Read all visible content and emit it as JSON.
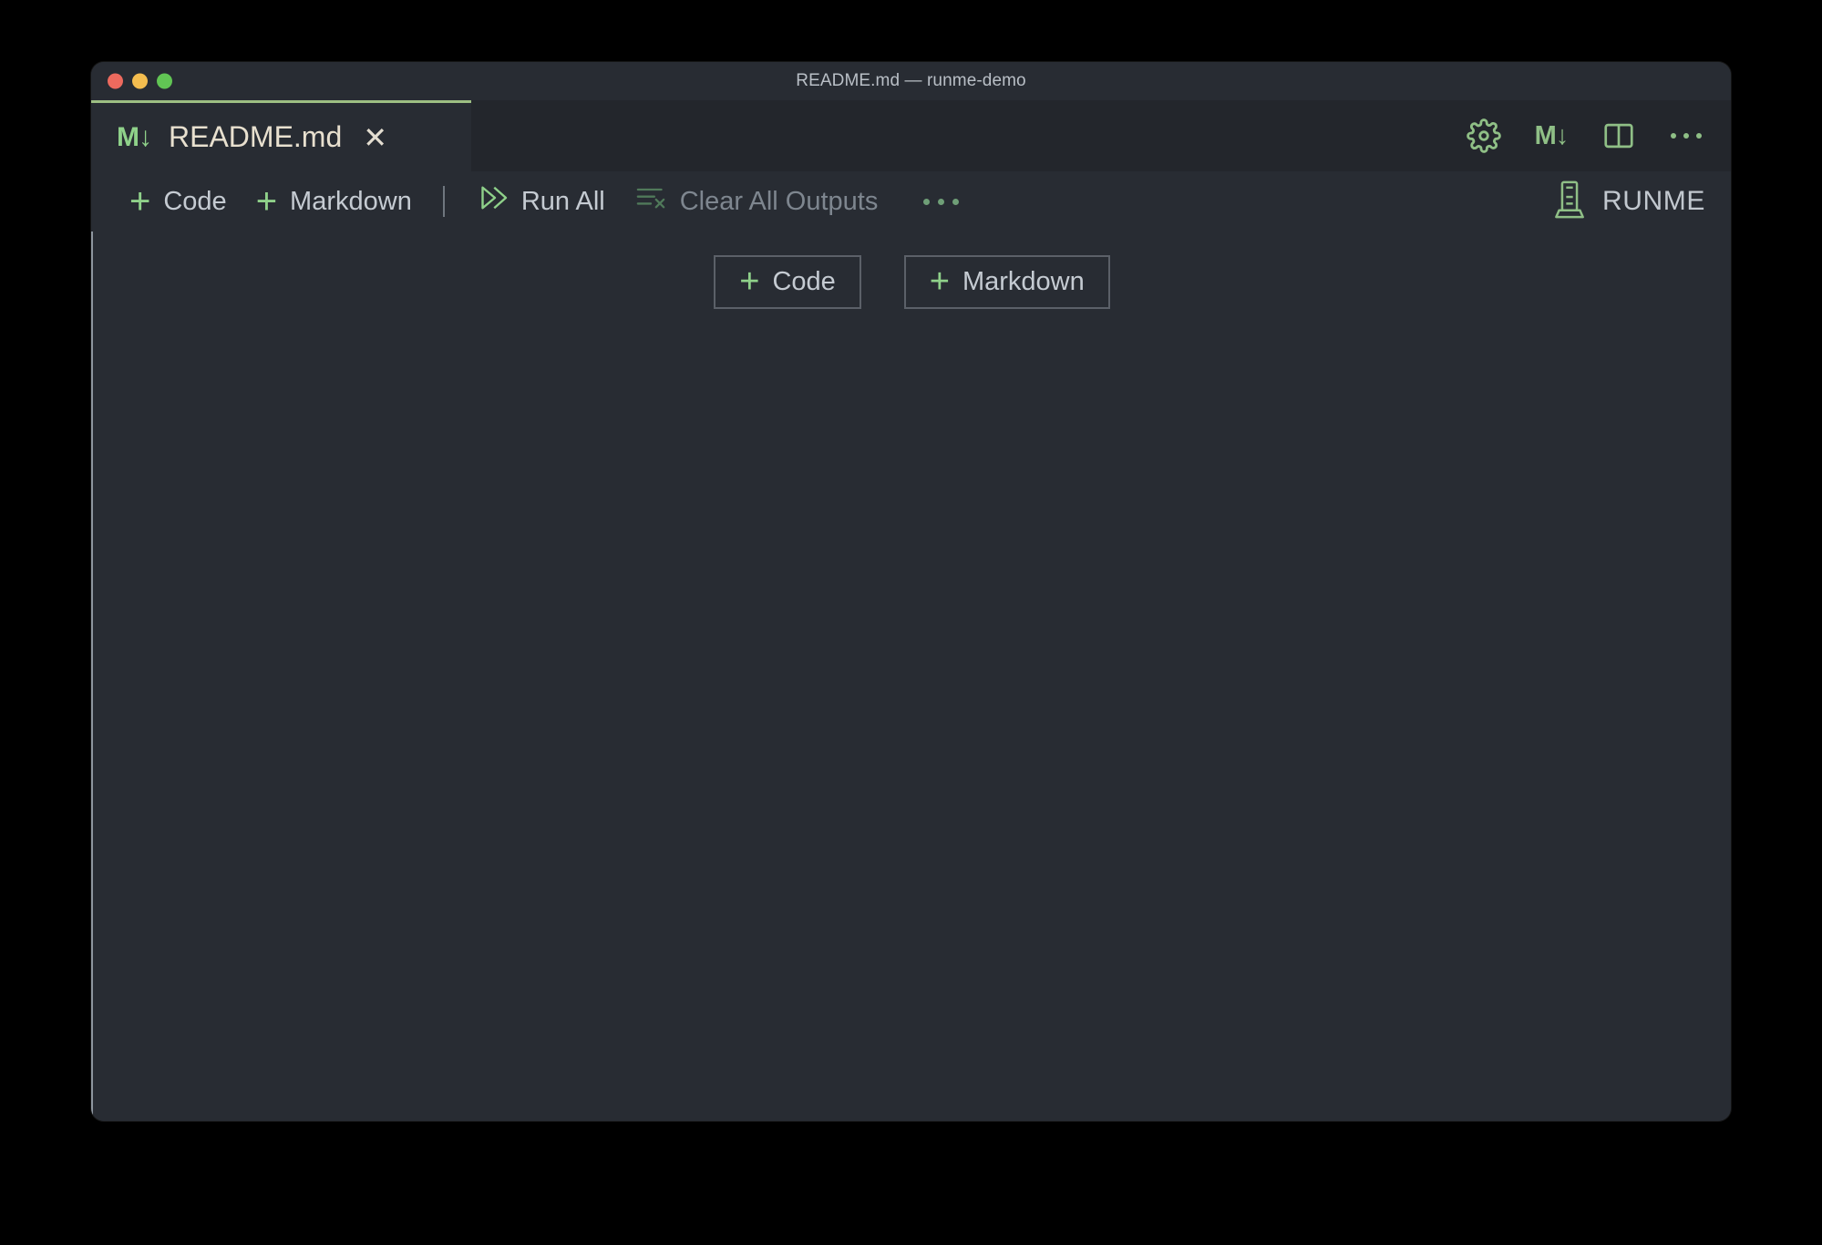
{
  "window": {
    "title": "README.md — runme-demo",
    "traffic_lights": [
      {
        "name": "close",
        "color": "#ED6A5E"
      },
      {
        "name": "minimize",
        "color": "#F4BD4F"
      },
      {
        "name": "maximize",
        "color": "#61C554"
      }
    ]
  },
  "tab": {
    "icon": "markdown-icon",
    "icon_glyph": "M↓",
    "label": "README.md",
    "close_glyph": "✕",
    "accent_color": "#9dbf83"
  },
  "tabbar_actions": [
    {
      "name": "settings-icon",
      "label": "gear-icon"
    },
    {
      "name": "open-markdown-preview-icon",
      "label": "M↓"
    },
    {
      "name": "split-editor-icon",
      "label": "split-panel-icon"
    },
    {
      "name": "more-actions-icon",
      "label": "ellipsis-icon"
    }
  ],
  "toolbar": {
    "add_code_label": "Code",
    "add_markdown_label": "Markdown",
    "run_all_label": "Run All",
    "clear_all_outputs_label": "Clear All Outputs",
    "clear_all_outputs_disabled": true,
    "more_label": "ellipsis-icon",
    "kernel_label": "RUNME",
    "kernel_icon": "server-icon",
    "accent_color": "#8fd18a"
  },
  "body": {
    "add_code_label": "Code",
    "add_markdown_label": "Markdown",
    "empty": true
  }
}
